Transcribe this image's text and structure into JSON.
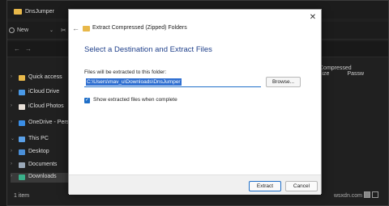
{
  "explorer": {
    "title": "DnsJumper",
    "new_label": "New",
    "chevron": "⌄",
    "columns": [
      "Compressed size",
      "Passw"
    ],
    "sidebar": [
      {
        "label": "Quick access",
        "icon": "star-icon",
        "color": "#e8b84a"
      },
      {
        "label": "iCloud Drive",
        "icon": "cloud-icon",
        "color": "#4a9ae8"
      },
      {
        "label": "iCloud Photos",
        "icon": "photos-icon",
        "color": "#e8e0d8"
      },
      {
        "label": "OneDrive - Personal",
        "icon": "onedrive-icon",
        "color": "#3a8ee6"
      },
      {
        "label": "This PC",
        "icon": "pc-icon",
        "color": "#5aa0e8"
      },
      {
        "label": "Desktop",
        "icon": "desktop-icon",
        "color": "#4a8fd8"
      },
      {
        "label": "Documents",
        "icon": "documents-icon",
        "color": "#9aa8b8"
      },
      {
        "label": "Downloads",
        "icon": "downloads-icon",
        "color": "#3ab08a"
      }
    ],
    "status": "1 item",
    "watermark": "wsxdn.com"
  },
  "dialog": {
    "window_title": "Extract Compressed (Zipped) Folders",
    "heading": "Select a Destination and Extract Files",
    "path_label": "Files will be extracted to this folder:",
    "path_value": "C:\\Users\\mav_u\\Downloads\\DnsJumper",
    "browse_label": "Browse...",
    "checkbox_label": "Show extracted files when complete",
    "checkbox_checked": true,
    "extract_label": "Extract",
    "cancel_label": "Cancel",
    "close_glyph": "✕",
    "back_glyph": "←"
  }
}
